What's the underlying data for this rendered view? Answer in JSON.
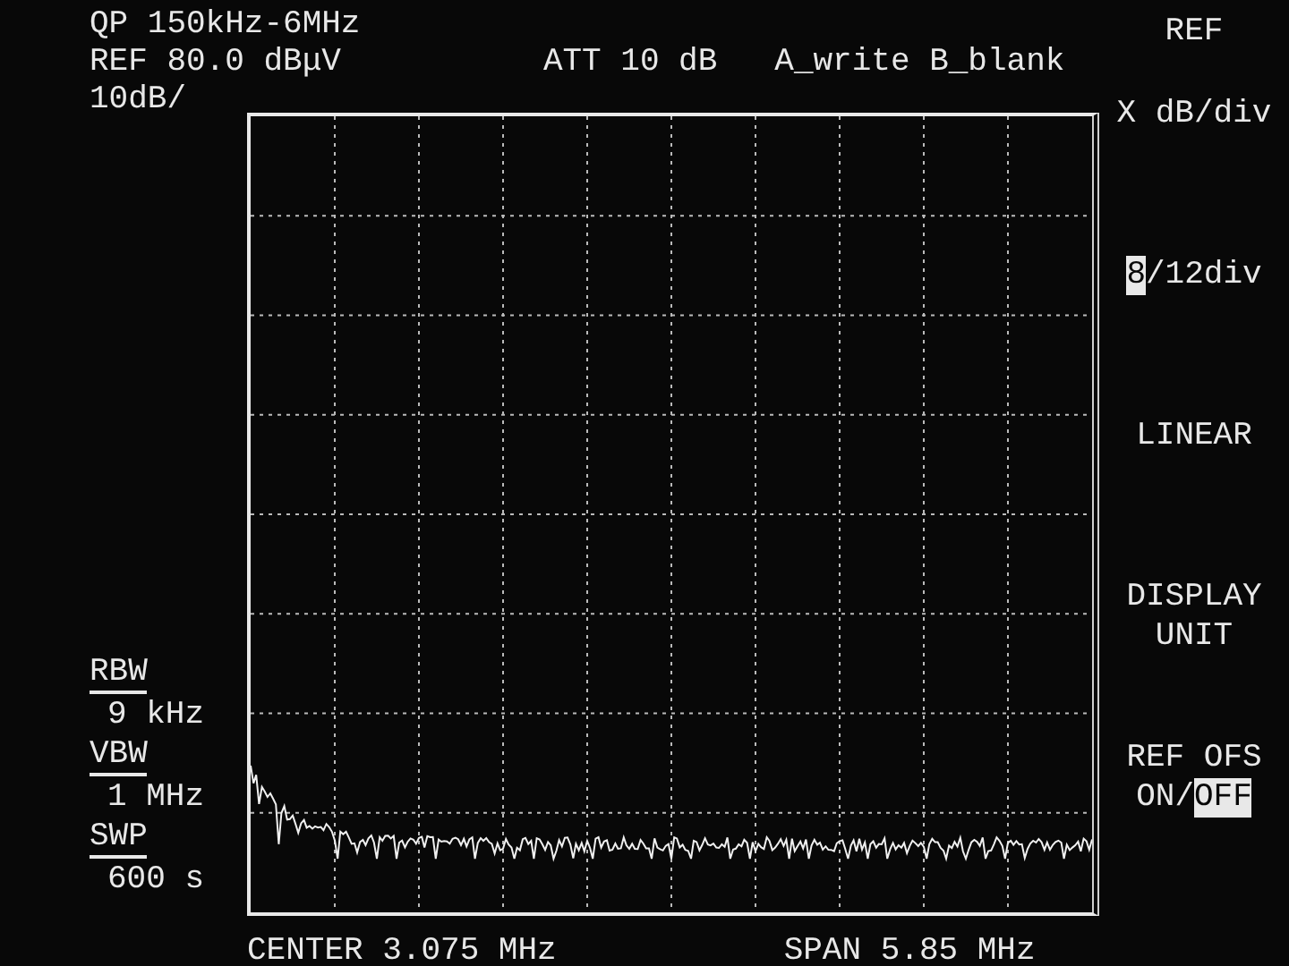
{
  "header": {
    "lines": [
      [
        {
          "text": "QP 150kHz-6MHz"
        }
      ],
      [
        {
          "text": "REF 80.0 dBμV"
        },
        {
          "text": "ATT 10 dB"
        },
        {
          "text": "A_write B_blank"
        }
      ],
      [
        {
          "text": "10dB/"
        }
      ]
    ]
  },
  "settings": [
    {
      "label": "RBW",
      "value": "9 kHz"
    },
    {
      "label": "VBW",
      "value": "1 MHz"
    },
    {
      "label": "SWP",
      "value": "600 s"
    }
  ],
  "footer": {
    "center": "CENTER 3.075 MHz",
    "span": "SPAN 5.85 MHz"
  },
  "softkeys": {
    "title": "REF",
    "keys": [
      {
        "lines": [
          [
            {
              "text": "X dB/div",
              "selected": false
            }
          ]
        ]
      },
      {
        "lines": [
          [
            {
              "text": "8",
              "selected": true
            },
            {
              "text": "/12div",
              "selected": false
            }
          ]
        ]
      },
      {
        "lines": [
          [
            {
              "text": "LINEAR",
              "selected": false
            }
          ]
        ]
      },
      {
        "lines": [
          [
            {
              "text": "DISPLAY",
              "selected": false
            }
          ],
          [
            {
              "text": "UNIT",
              "selected": false
            }
          ]
        ]
      },
      {
        "lines": [
          [
            {
              "text": "REF OFS",
              "selected": false
            }
          ],
          [
            {
              "text": "ON/",
              "selected": false
            },
            {
              "text": "OFF",
              "selected": true
            }
          ]
        ]
      }
    ]
  }
}
